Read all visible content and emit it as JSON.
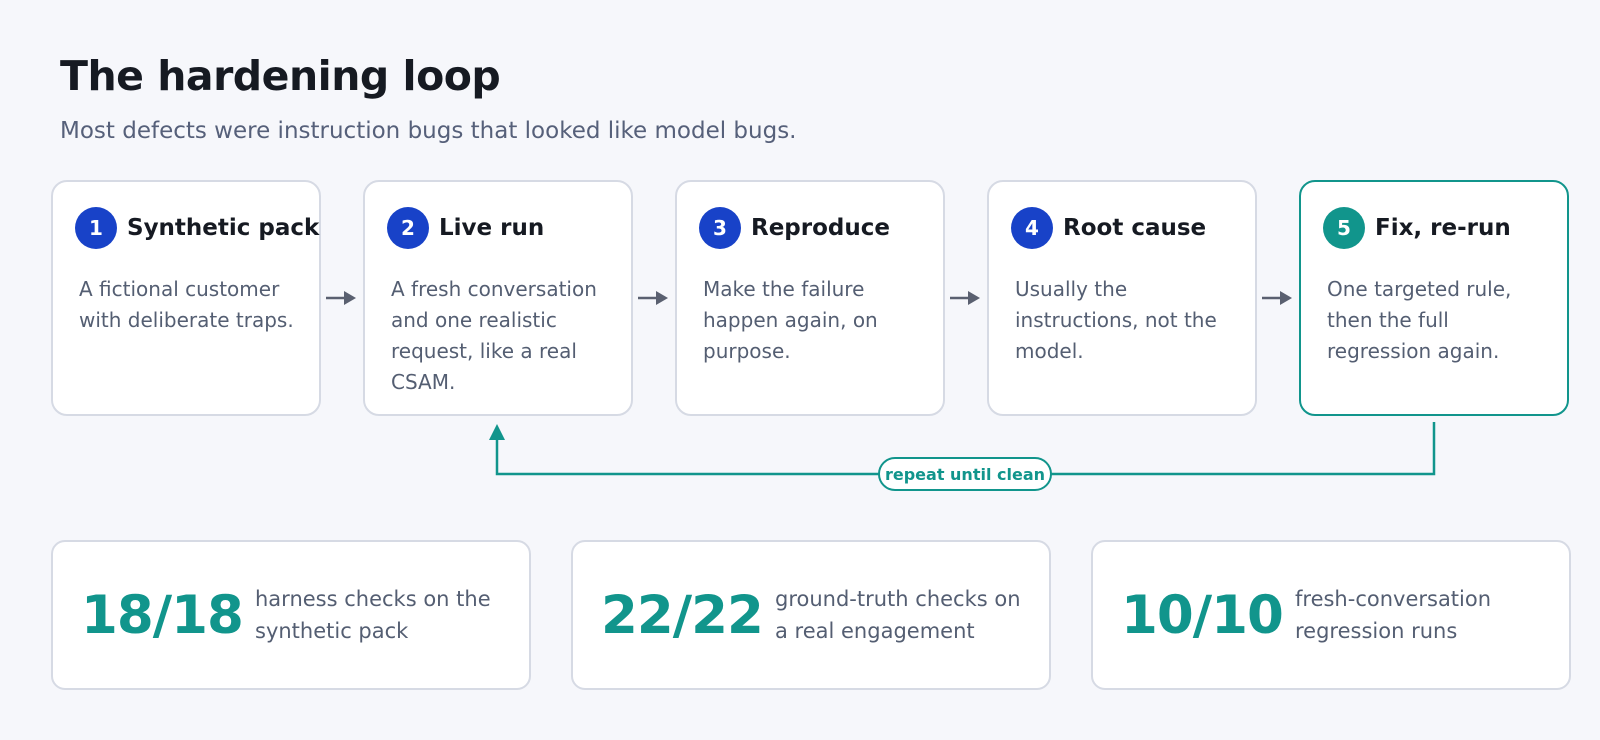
{
  "header": {
    "title": "The hardening loop",
    "subtitle": "Most defects were instruction bugs that looked like model bugs."
  },
  "steps": [
    {
      "number": "1",
      "title": "Synthetic pack",
      "description": "A fictional customer with deliberate traps."
    },
    {
      "number": "2",
      "title": "Live run",
      "description": "A fresh conversation and one realistic request, like a real CSAM."
    },
    {
      "number": "3",
      "title": "Reproduce",
      "description": "Make the failure happen again, on purpose."
    },
    {
      "number": "4",
      "title": "Root cause",
      "description": "Usually the instructions, not the model."
    },
    {
      "number": "5",
      "title": "Fix, re-run",
      "description": "One targeted rule, then the full regression again."
    }
  ],
  "loop": {
    "label": "repeat until clean"
  },
  "stats": [
    {
      "value": "18/18",
      "label": "harness checks on the synthetic pack"
    },
    {
      "value": "22/22",
      "label": "ground-truth checks on a real engagement"
    },
    {
      "value": "10/10",
      "label": "fresh-conversation regression runs"
    }
  ],
  "colors": {
    "step_badge": "#1842c8",
    "accent_teal": "#11958c",
    "arrow": "#5a6070",
    "card_border": "#d6dae4"
  },
  "icons": {
    "flow_arrow": "arrow-right-icon",
    "loop_arrow": "arrow-up-icon"
  }
}
